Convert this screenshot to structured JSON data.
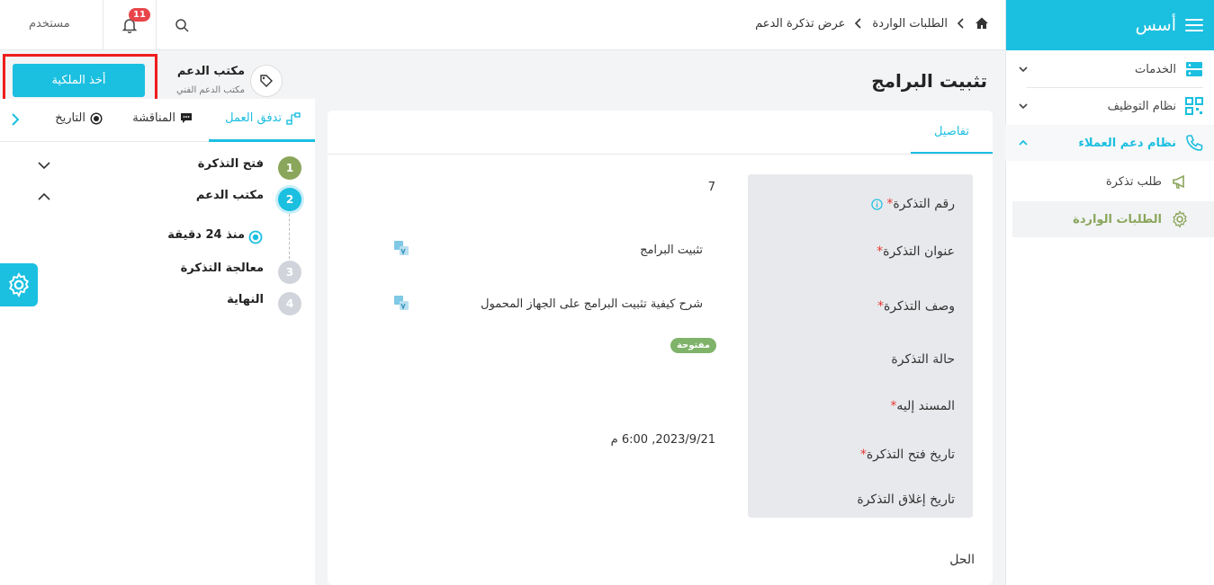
{
  "sidebar": {
    "brand": "أسس",
    "items": [
      {
        "label": "الخدمات",
        "icon": "server-icon"
      },
      {
        "label": "نظام التوظيف",
        "icon": "qr-icon"
      },
      {
        "label": "نظام دعم العملاء",
        "icon": "phone-icon"
      }
    ],
    "sub_items": [
      {
        "label": "طلب تذكرة",
        "icon": "megaphone-icon"
      },
      {
        "label": "الطلبات الواردة",
        "icon": "gear-icon"
      }
    ]
  },
  "header": {
    "breadcrumb": [
      "الطلبات الواردة",
      "عرض تذكرة الدعم"
    ],
    "user_label": "مستخدم",
    "notification_count": "11"
  },
  "page": {
    "title": "تثبيت البرامج"
  },
  "details": {
    "tab_label": "تفاصيل",
    "fields": [
      {
        "label": "رقم التذكرة",
        "required": "*",
        "value": "7"
      },
      {
        "label": "عنوان التذكرة",
        "required": "*",
        "value": "تثبيت البرامج"
      },
      {
        "label": "وصف التذكرة",
        "required": "*",
        "value": "شرح كيفية تثبيت البرامج على الجهاز المحمول"
      },
      {
        "label": "حالة التذكرة",
        "required": "",
        "value": "مفتوحة"
      },
      {
        "label": "المسند إليه",
        "required": "*",
        "value": ""
      },
      {
        "label": "تاريخ فتح التذكرة",
        "required": "*",
        "value": "2023/9/21, 6:00 م"
      },
      {
        "label": "تاريخ إغلاق التذكرة",
        "required": "",
        "value": ""
      }
    ],
    "solution_label": "الحل"
  },
  "assignee": {
    "name": "مكتب الدعم",
    "subtitle": "مكتب الدعم الفني",
    "take_ownership_label": "أخذ الملكية"
  },
  "workflow": {
    "tabs": [
      {
        "label": "تدفق العمل",
        "icon": "workflow-icon"
      },
      {
        "label": "المناقشة",
        "icon": "chat-icon"
      },
      {
        "label": "التاريخ",
        "icon": "history-icon"
      }
    ],
    "steps": [
      {
        "number": "1",
        "label": "فتح التذكرة",
        "color": "#8aa65b"
      },
      {
        "number": "2",
        "label": "مكتب الدعم",
        "color": "#1bbfe0"
      },
      {
        "number": "3",
        "label": "معالجة التذكرة",
        "color": "#d1d5db"
      },
      {
        "number": "4",
        "label": "النهاية",
        "color": "#d1d5db"
      }
    ],
    "step_time": "منذ 24 دقيقة"
  },
  "colors": {
    "accent": "#1bbfe0",
    "success": "#8aa65b",
    "danger": "#e8454b"
  }
}
